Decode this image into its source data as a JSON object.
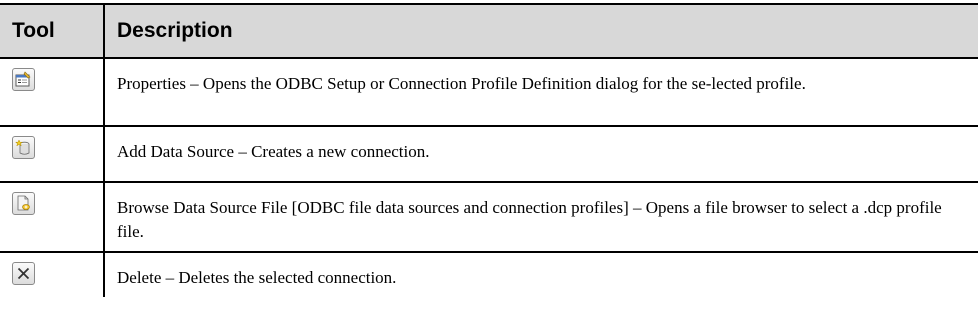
{
  "table": {
    "headers": {
      "tool": "Tool",
      "description": "Description"
    },
    "rows": [
      {
        "icon": "properties-icon",
        "description": "Properties – Opens the ODBC Setup or Connection Profile Definition dialog for the se-lected profile."
      },
      {
        "icon": "add-data-source-icon",
        "description": "Add Data Source – Creates a new connection."
      },
      {
        "icon": "browse-data-source-file-icon",
        "description": "Browse Data Source File [ODBC file data sources and connection profiles] – Opens a file browser to select a .dcp profile file."
      },
      {
        "icon": "delete-icon",
        "description": "Delete – Deletes the selected connection."
      }
    ]
  }
}
